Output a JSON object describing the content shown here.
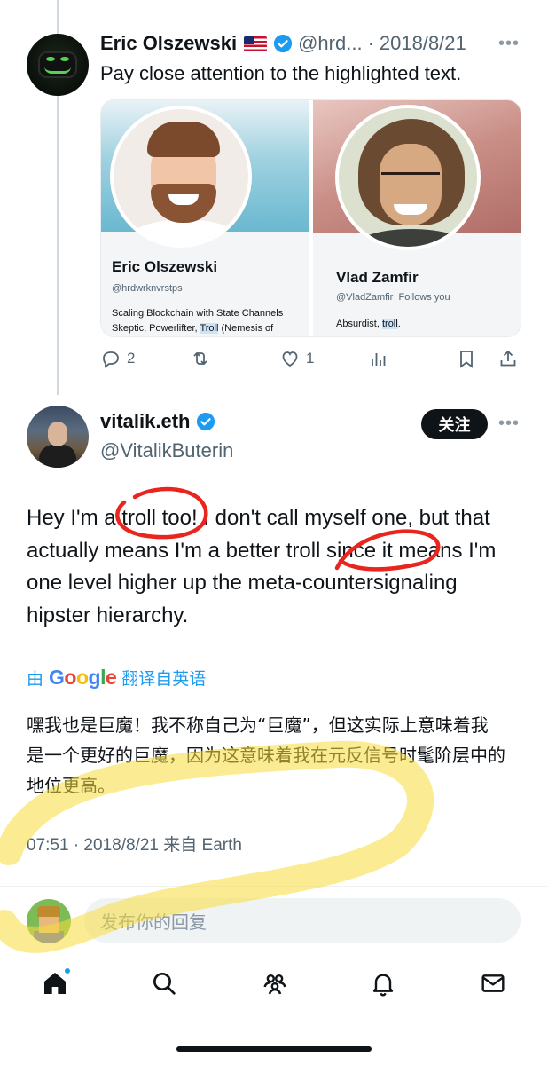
{
  "parent_tweet": {
    "author_name": "Eric Olszewski",
    "author_handle": "@hrd...",
    "separator": "·",
    "date": "2018/8/21",
    "text": "Pay close attention to the highlighted text.",
    "cards": [
      {
        "name": "Eric Olszewski",
        "handle": "@hrdwrknvrstps",
        "bio_line1_before": "Scaling Blockchain with State Channels",
        "bio_line2_before": "Skeptic, Powerlifter, ",
        "bio_highlight": "Troll",
        "bio_line2_after": " (Nemesis of"
      },
      {
        "name": "Vlad Zamfir",
        "handle": "@VladZamfir",
        "follows_you": "Follows you",
        "bio_before": "Absurdist, ",
        "bio_highlight": "troll",
        "bio_after": "."
      }
    ],
    "actions": {
      "reply_count": "2",
      "like_count": "1"
    }
  },
  "main_tweet": {
    "author_name": "vitalik.eth",
    "author_handle": "@VitalikButerin",
    "follow_label": "关注",
    "text": "Hey I'm a troll too! I don't call myself one, but that actually means I'm a better troll since it means I'm one level higher up the meta-countersignaling hipster hierarchy.",
    "translate_prefix": "由",
    "translate_suffix": "翻译自英语",
    "translated_text": "嘿我也是巨魔！我不称自己为“巨魔”，但这实际上意味着我是一个更好的巨魔，因为这意味着我在元反信号时髦阶层中的地位更高。",
    "timestamp": "07:51 · 2018/8/21 来自 Earth"
  },
  "reply": {
    "placeholder": "发布你的回复"
  },
  "colors": {
    "accent": "#1d9bf0",
    "red_annotation": "#e8261f",
    "yellow_annotation": "#f7dc3c"
  },
  "icons": [
    "reply-icon",
    "retweet-icon",
    "like-icon",
    "views-icon",
    "bookmark-icon",
    "share-icon",
    "home-icon",
    "search-icon",
    "communities-icon",
    "notifications-icon",
    "messages-icon",
    "verified-badge-icon"
  ]
}
